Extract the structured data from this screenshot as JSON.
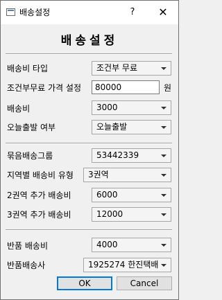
{
  "window": {
    "title": "배송설정",
    "help_glyph": "?",
    "close_glyph": "✕"
  },
  "heading": "배송설정",
  "fields": {
    "shipping_type": {
      "label": "배송비 타입",
      "value": "조건부 무료"
    },
    "free_condition_price": {
      "label": "조건부무료 가격 설정",
      "value": "80000",
      "unit": "원"
    },
    "shipping_fee": {
      "label": "배송비",
      "value": "3000"
    },
    "same_day_dispatch": {
      "label": "오늘출발 여부",
      "value": "오늘출발"
    },
    "bundle_group": {
      "label": "묶음배송그룹",
      "value": "53442339"
    },
    "regional_fee_type": {
      "label": "지역별 배송비 유형",
      "value": "3권역"
    },
    "zone2_extra_fee": {
      "label": "2권역 추가 배송비",
      "value": "6000"
    },
    "zone3_extra_fee": {
      "label": "3권역 추가 배송비",
      "value": "12000"
    },
    "return_fee": {
      "label": "반품 배송비",
      "value": "4000"
    },
    "return_courier": {
      "label": "반품배송사",
      "value": "1925274 한진택배"
    }
  },
  "buttons": {
    "ok": "OK",
    "cancel": "Cancel"
  }
}
